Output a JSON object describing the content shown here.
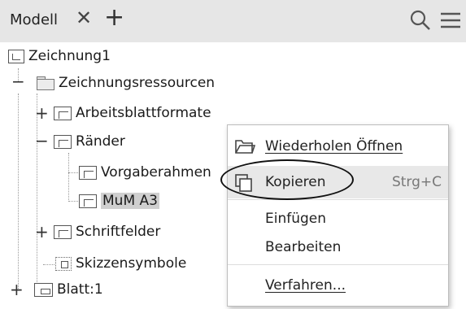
{
  "header": {
    "tab_label": "Modell",
    "close_glyph": "✕",
    "add_glyph": "+",
    "search_icon": "search-icon",
    "menu_icon": "hamburger-menu-icon"
  },
  "tree": {
    "root": "Zeichnung1",
    "resources": "Zeichnungsressourcen",
    "sheet_formats": "Arbeitsblattformate",
    "borders": "Ränder",
    "default_frame": "Vorgaberahmen",
    "mum_a3": "MuM A3",
    "title_blocks": "Schriftfelder",
    "sketch_symbols": "Skizzensymbole",
    "sheet": "Blatt:1",
    "expand_glyph": "+",
    "collapse_glyph": "−"
  },
  "context_menu": {
    "items": [
      {
        "label": "Wiederholen Öffnen",
        "icon": "open-folder-icon",
        "shortcut": ""
      },
      {
        "label": "Kopieren",
        "icon": "copy-icon",
        "shortcut": "Strg+C"
      },
      {
        "label": "Einfügen",
        "icon": "",
        "shortcut": ""
      },
      {
        "label": "Bearbeiten",
        "icon": "",
        "shortcut": ""
      },
      {
        "label": "Verfahren...",
        "icon": "",
        "shortcut": ""
      }
    ]
  }
}
